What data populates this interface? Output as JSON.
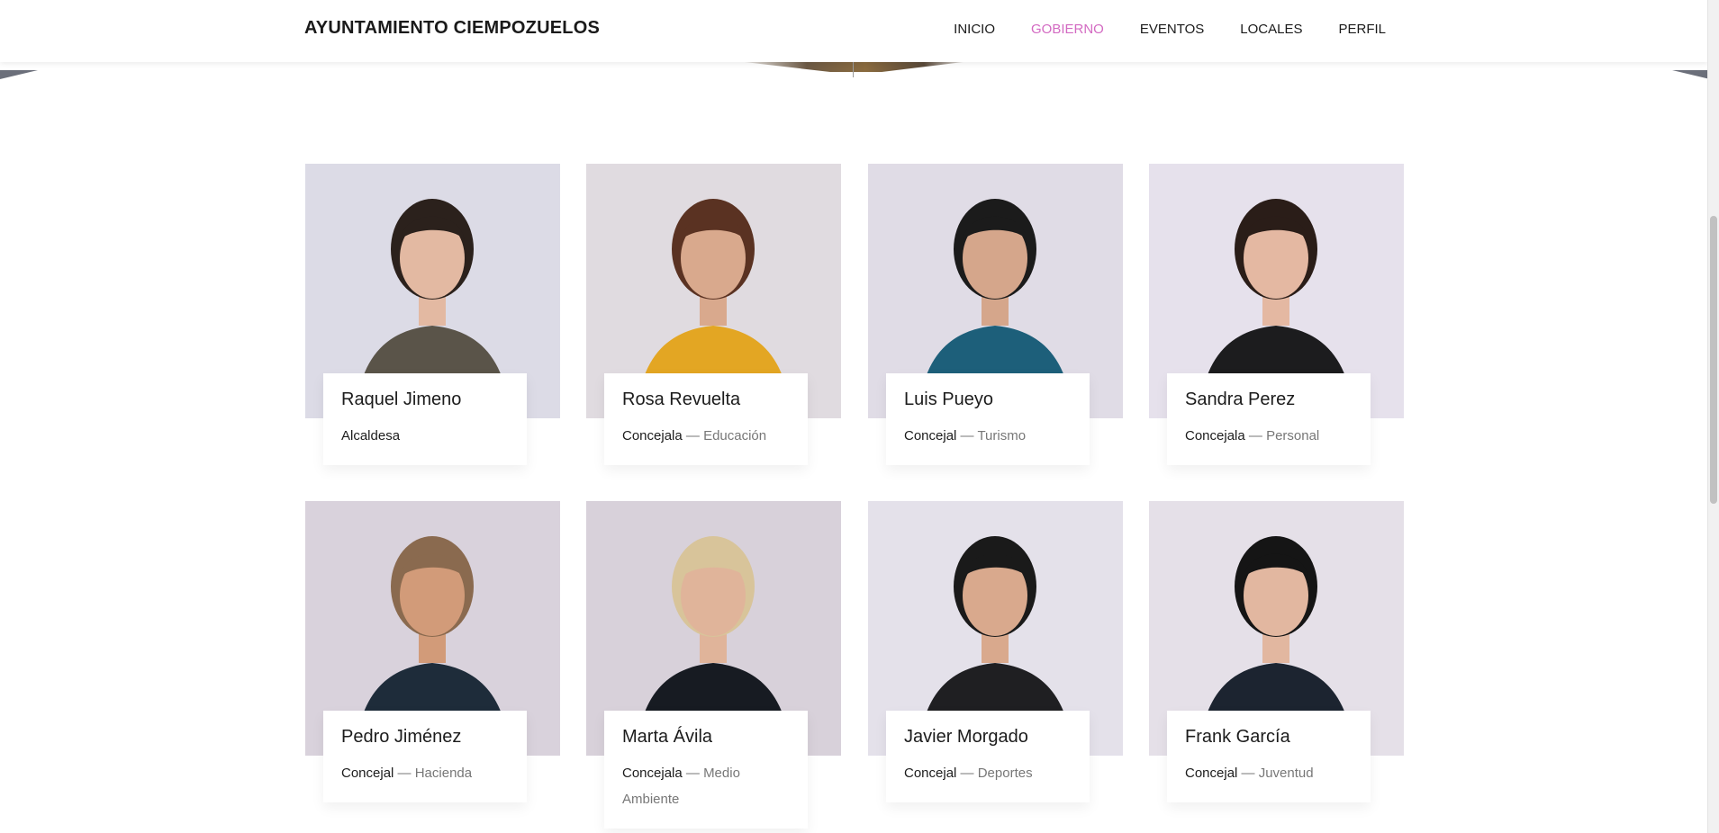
{
  "header": {
    "brand": "AYUNTAMIENTO CIEMPOZUELOS",
    "nav": [
      {
        "label": "INICIO",
        "active": false
      },
      {
        "label": "GOBIERNO",
        "active": true
      },
      {
        "label": "EVENTOS",
        "active": false
      },
      {
        "label": "LOCALES",
        "active": false
      },
      {
        "label": "PERFIL",
        "active": false
      }
    ],
    "active_color": "#d36ac2"
  },
  "team": [
    {
      "name": "Raquel Jimeno",
      "position": "Alcaldesa",
      "area": "",
      "bg": "#dcdbe6",
      "clothes": "#5a5449",
      "hair": "#2b211c",
      "skin": "#e3b9a2"
    },
    {
      "name": "Rosa Revuelta",
      "position": "Concejala",
      "area": "Educación",
      "bg": "#e0dbe0",
      "clothes": "#e3a623",
      "hair": "#5a3222",
      "skin": "#d9a98d"
    },
    {
      "name": "Luis Pueyo",
      "position": "Concejal",
      "area": "Turismo",
      "bg": "#e0dce6",
      "clothes": "#1d5f7a",
      "hair": "#1b1b1b",
      "skin": "#d5a68b"
    },
    {
      "name": "Sandra Perez",
      "position": "Concejala",
      "area": "Personal",
      "bg": "#e6e1ec",
      "clothes": "#1c1c1e",
      "hair": "#2a1d18",
      "skin": "#e4b8a2"
    },
    {
      "name": "Pedro Jiménez",
      "position": "Concejal",
      "area": "Hacienda",
      "bg": "#d9d2dc",
      "clothes": "#1e2c3a",
      "hair": "#8a6a4f",
      "skin": "#d29b79"
    },
    {
      "name": "Marta Ávila",
      "position": "Concejala",
      "area": "Medio Ambiente",
      "bg": "#d8d1da",
      "clothes": "#171b22",
      "hair": "#d8c49a",
      "skin": "#e0b49a"
    },
    {
      "name": "Javier Morgado",
      "position": "Concejal",
      "area": "Deportes",
      "bg": "#e4e1ea",
      "clothes": "#1f1f22",
      "hair": "#1a1a1a",
      "skin": "#d9a98d"
    },
    {
      "name": "Frank García",
      "position": "Concejal",
      "area": "Juventud",
      "bg": "#e5e0e8",
      "clothes": "#1c2430",
      "hair": "#151515",
      "skin": "#e2b7a0"
    }
  ],
  "separator": "—"
}
